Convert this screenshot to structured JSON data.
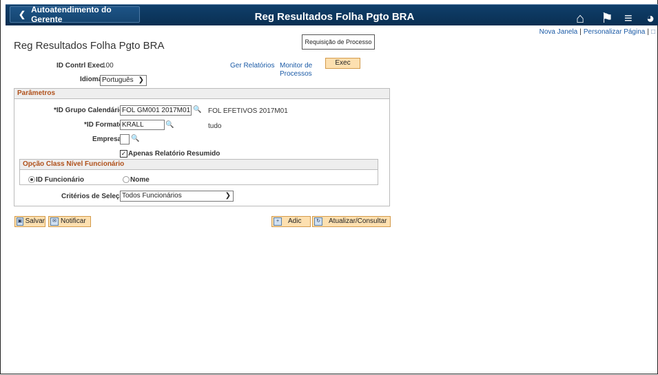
{
  "header": {
    "back_label": "Autoatendimento do Gerente",
    "title": "Reg Resultados Folha Pgto BRA"
  },
  "top_links": {
    "new_window": "Nova Janela",
    "personalize": "Personalizar Página"
  },
  "request_process_label": "Requisição de Processo",
  "page_title": "Reg Resultados Folha Pgto BRA",
  "run_control": {
    "label": "ID Contrl Exec",
    "value": "100"
  },
  "links": {
    "report_manager": "Ger Relatórios",
    "monitor_line1": "Monitor de",
    "monitor_line2": "Processos"
  },
  "exec_label": "Exec",
  "language": {
    "label": "Idioma",
    "value": "Português"
  },
  "params": {
    "title": "Parâmetros",
    "calendar_group_label": "*ID Grupo Calendários",
    "calendar_group_value": "FOL GM001 2017M01",
    "calendar_group_desc": "FOL EFETIVOS 2017M01",
    "format_label": "*ID Formato",
    "format_value": "KRALL",
    "format_desc": "tudo",
    "company_label": "Empresa",
    "company_value": "",
    "summary_label": "Apenas Relatório Resumido",
    "summary_checked": true,
    "option_group_title": "Opção Class Nível Funcionário",
    "radio_employee": "ID Funcionário",
    "radio_name": "Nome",
    "criteria_label": "Critérios de Seleção",
    "criteria_value": "Todos Funcionários"
  },
  "buttons": {
    "save": "Salvar",
    "notify": "Notificar",
    "add": "Adic",
    "update": "Atualizar/Consultar"
  }
}
